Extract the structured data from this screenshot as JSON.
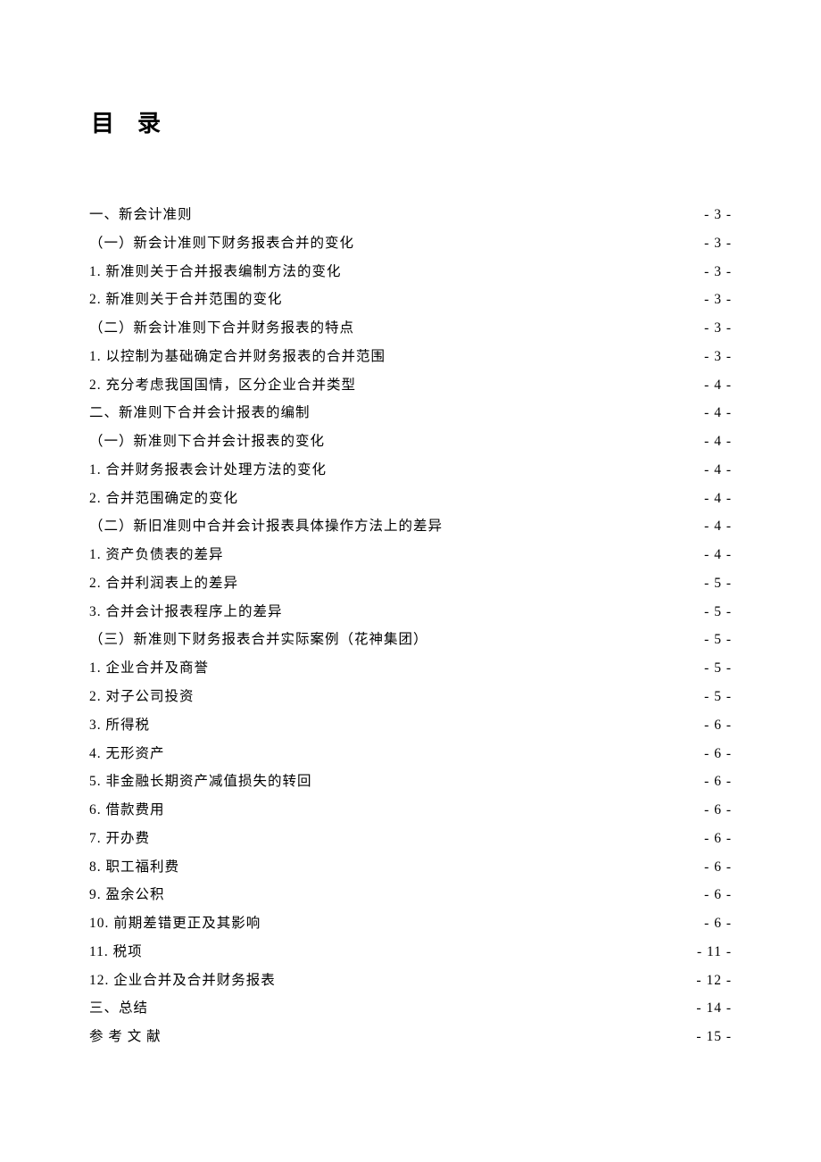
{
  "title": "目录",
  "entries": [
    {
      "label": "一、新会计准则",
      "page": "- 3 -"
    },
    {
      "label": "（一）新会计准则下财务报表合并的变化 ",
      "page": "- 3 -"
    },
    {
      "label": "1. 新准则关于合并报表编制方法的变化 ",
      "page": "- 3 -"
    },
    {
      "label": "2. 新准则关于合并范围的变化 ",
      "page": "- 3 -"
    },
    {
      "label": "（二）新会计准则下合并财务报表的特点 ",
      "page": "- 3 -"
    },
    {
      "label": "1. 以控制为基础确定合并财务报表的合并范围 ",
      "page": "- 3 -"
    },
    {
      "label": "2. 充分考虑我国国情，区分企业合并类型 ",
      "page": "- 4 -"
    },
    {
      "label": "二、新准则下合并会计报表的编制",
      "page": "- 4 -"
    },
    {
      "label": "（一）新准则下合并会计报表的变化 ",
      "page": "- 4 -"
    },
    {
      "label": "1. 合并财务报表会计处理方法的变化 ",
      "page": "- 4 -"
    },
    {
      "label": "2. 合并范围确定的变化 ",
      "page": "- 4 -"
    },
    {
      "label": "（二）新旧准则中合并会计报表具体操作方法上的差异 ",
      "page": "- 4 -"
    },
    {
      "label": "1. 资产负债表的差异 ",
      "page": "- 4 -"
    },
    {
      "label": "2. 合并利润表上的差异 ",
      "page": "- 5 -"
    },
    {
      "label": "3. 合并会计报表程序上的差异 ",
      "page": "- 5 -"
    },
    {
      "label": "（三）新准则下财务报表合并实际案例（花神集团） ",
      "page": "- 5 -"
    },
    {
      "label": "1. 企业合并及商誉 ",
      "page": "- 5 -"
    },
    {
      "label": "2. 对子公司投资 ",
      "page": "- 5 -"
    },
    {
      "label": "3. 所得税 ",
      "page": "- 6 -"
    },
    {
      "label": "4. 无形资产 ",
      "page": "- 6 -"
    },
    {
      "label": "5. 非金融长期资产减值损失的转回 ",
      "page": "- 6 -"
    },
    {
      "label": "6.  借款费用 ",
      "page": "- 6 -"
    },
    {
      "label": "7. 开办费 ",
      "page": "- 6 -"
    },
    {
      "label": "8. 职工福利费 ",
      "page": "- 6 -"
    },
    {
      "label": "9. 盈余公积 ",
      "page": "- 6 -"
    },
    {
      "label": "10. 前期差错更正及其影响 ",
      "page": "- 6 -"
    },
    {
      "label": "11.  税项 ",
      "page": "- 11 -"
    },
    {
      "label": "12.  企业合并及合并财务报表 ",
      "page": "- 12 -"
    },
    {
      "label": "三、总结",
      "page": "- 14 -"
    },
    {
      "label": "参 考 文 献",
      "page": "- 15 -"
    }
  ]
}
